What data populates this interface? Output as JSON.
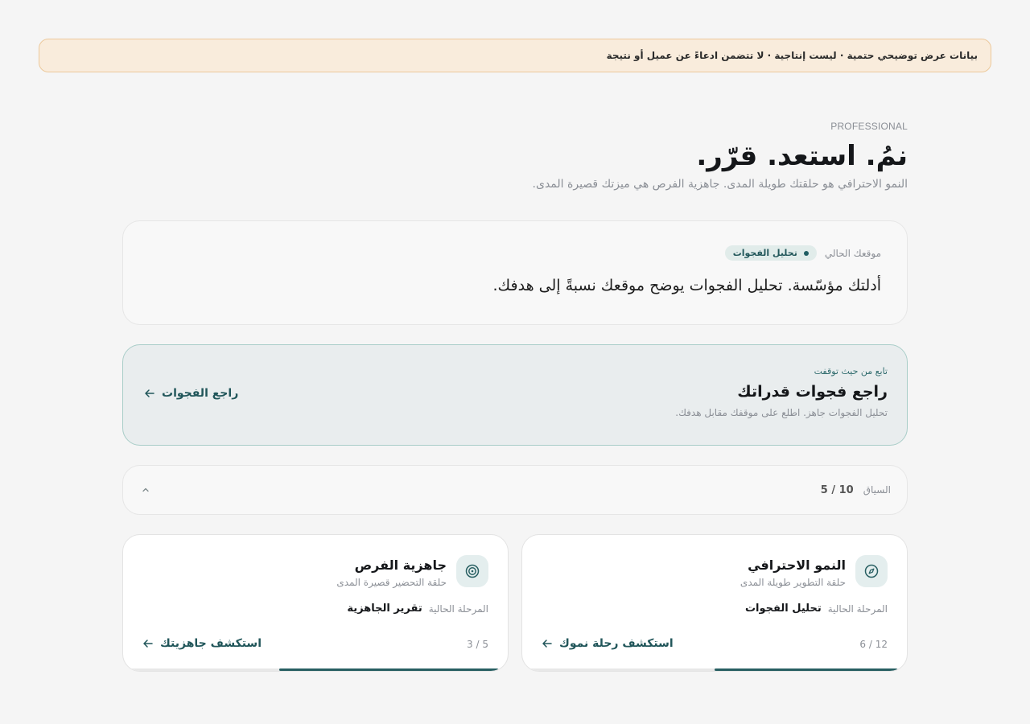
{
  "banner": {
    "text": "بيانات عرض توضيحي حتمية · ليست إنتاجية · لا تتضمن ادعاءً عن عميل أو نتيجة"
  },
  "hero": {
    "kicker": "PROFESSIONAL",
    "title": "نمُ. استعد. قرّر.",
    "subtitle": "النمو الاحترافي هو حلقتك طويلة المدى. جاهزية الفرص هي ميزتك قصيرة المدى."
  },
  "position": {
    "label": "موقعك الحالي",
    "chip": "تحليل الفجوات",
    "text": "أدلتك مؤسّسة. تحليل الفجوات يوضح موقعك نسبةً إلى هدفك."
  },
  "resume": {
    "kicker": "تابع من حيث توقفت",
    "title": "راجع فجوات قدراتك",
    "description": "تحليل الفجوات جاهز. اطلع على موقفك مقابل هدفك.",
    "action": "راجع الفجوات"
  },
  "context": {
    "label": "السياق",
    "value": "5 / 10",
    "toggle_icon": "chevron-up-icon"
  },
  "loops": [
    {
      "id": "growth",
      "icon": "compass-icon",
      "title": "النمو الاحترافي",
      "subtitle": "حلقة التطوير طويلة المدى",
      "stage_label": "المرحلة الحالية",
      "stage_value": "تحليل الفجوات",
      "count": "6 / 12",
      "progress": 0.5,
      "action": "استكشف رحلة نموك"
    },
    {
      "id": "readiness",
      "icon": "target-icon",
      "title": "جاهزية الفرص",
      "subtitle": "حلقة التحضير قصيرة المدى",
      "stage_label": "المرحلة الحالية",
      "stage_value": "تقرير الجاهزية",
      "count": "3 / 5",
      "progress": 0.6,
      "action": "استكشف جاهزيتك"
    }
  ],
  "colors": {
    "accent": "#21565a",
    "banner_bg": "#f9ecdc",
    "banner_border": "#ecc89b",
    "resume_bg": "#e9edee",
    "resume_border": "#a9cdc8"
  }
}
